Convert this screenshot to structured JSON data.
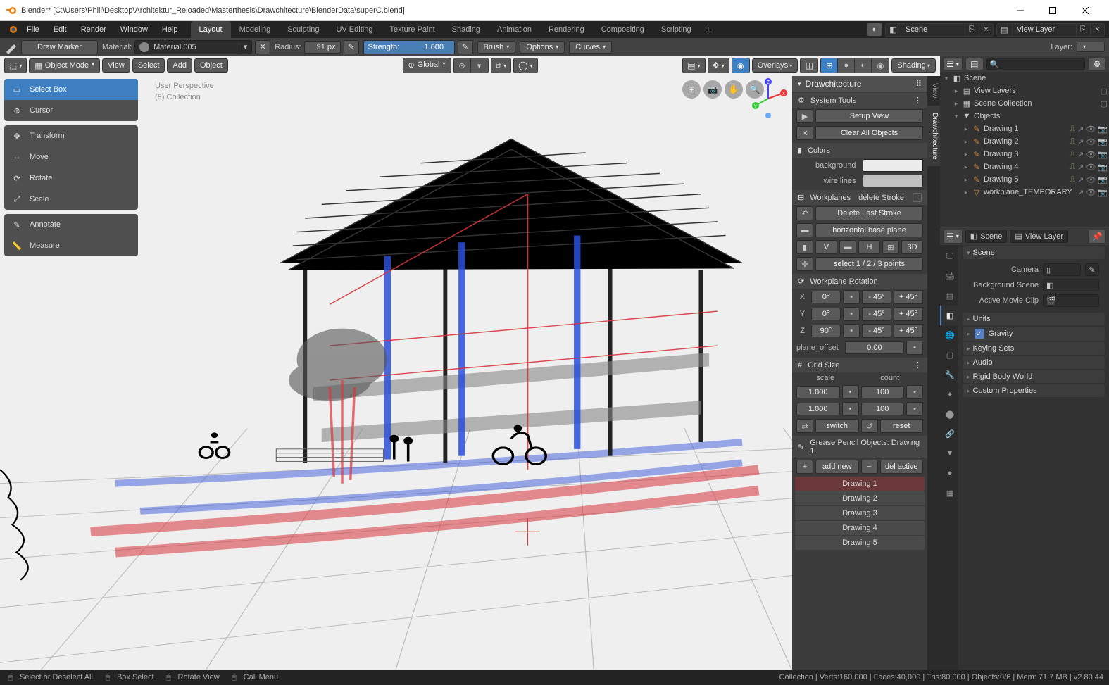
{
  "titlebar": {
    "title": "Blender* [C:\\Users\\Phili\\Desktop\\Architektur_Reloaded\\Masterthesis\\Drawchitecture\\BlenderData\\superC.blend]"
  },
  "menubar": {
    "items": [
      "File",
      "Edit",
      "Render",
      "Window",
      "Help"
    ],
    "tabs": [
      "Layout",
      "Modeling",
      "Sculpting",
      "UV Editing",
      "Texture Paint",
      "Shading",
      "Animation",
      "Rendering",
      "Compositing",
      "Scripting"
    ],
    "active_tab": 0,
    "scene_label": "Scene",
    "viewlayer_label": "View Layer"
  },
  "toolbar2": {
    "draw_label": "Draw Marker",
    "material_label": "Material:",
    "material_value": "Material.005",
    "radius_label": "Radius:",
    "radius_value": "91 px",
    "strength_label": "Strength:",
    "strength_value": "1.000",
    "brush_label": "Brush",
    "options_label": "Options",
    "curves_label": "Curves",
    "layer_label": "Layer:"
  },
  "vp_header": {
    "mode": "Object Mode",
    "view": "View",
    "select": "Select",
    "add": "Add",
    "object": "Object",
    "orientation": "Global",
    "overlays": "Overlays",
    "shading": "Shading"
  },
  "tools": {
    "groups": [
      [
        "Select Box",
        "Cursor"
      ],
      [
        "Transform",
        "Move",
        "Rotate",
        "Scale"
      ],
      [
        "Annotate",
        "Measure"
      ]
    ],
    "active": "Select Box"
  },
  "vp_overlay": {
    "line1": "User Perspective",
    "line2": "(9) Collection"
  },
  "npanel": {
    "title": "Drawchitecture",
    "tabs": [
      "View",
      "Drawchitecture"
    ],
    "active_tab": 1,
    "system_tools": {
      "title": "System Tools",
      "setup": "Setup View",
      "clear": "Clear All Objects"
    },
    "colors": {
      "title": "Colors",
      "background": "background",
      "wire": "wire lines",
      "bg_hex": "#ececec",
      "wire_hex": "#c0c0c0"
    },
    "workplanes": {
      "title": "Workplanes",
      "delete_stroke": "delete Stroke",
      "delete_last": "Delete Last Stroke",
      "horizontal": "horizontal base plane",
      "modes": [
        "V",
        "H",
        "3D"
      ],
      "select_pts": "select 1 / 2 / 3 points"
    },
    "rotation": {
      "title": "Workplane Rotation",
      "axes": [
        "X",
        "Y",
        "Z"
      ],
      "vals": [
        "0°",
        "0°",
        "90°"
      ],
      "minus": "- 45°",
      "plus": "+ 45°",
      "offset_label": "plane_offset",
      "offset_value": "0.00"
    },
    "grid": {
      "title": "Grid Size",
      "scale_label": "scale",
      "count_label": "count",
      "scale1": "1.000",
      "scale2": "1.000",
      "count1": "100",
      "count2": "100",
      "switch": "switch",
      "reset": "reset"
    },
    "gp": {
      "title": "Grease Pencil Objects: Drawing 1",
      "add": "add new",
      "del": "del active",
      "items": [
        "Drawing 1",
        "Drawing 2",
        "Drawing 3",
        "Drawing 4",
        "Drawing 5"
      ],
      "active": 0
    }
  },
  "outliner": {
    "scene": "Scene",
    "view_layers": "View Layers",
    "scene_collection": "Scene Collection",
    "objects": "Objects",
    "items": [
      "Drawing 1",
      "Drawing 2",
      "Drawing 3",
      "Drawing 4",
      "Drawing 5",
      "workplane_TEMPORARY"
    ]
  },
  "props": {
    "scene_tab": "Scene",
    "viewlayer_tab": "View Layer",
    "panels": {
      "scene": "Scene",
      "camera": "Camera",
      "bg_scene": "Background Scene",
      "movie_clip": "Active Movie Clip",
      "units": "Units",
      "gravity": "Gravity",
      "keying": "Keying Sets",
      "audio": "Audio",
      "rigid": "Rigid Body World",
      "custom": "Custom Properties"
    }
  },
  "statusbar": {
    "items": [
      "Select or Deselect All",
      "Box Select",
      "Rotate View",
      "Call Menu"
    ],
    "stats": "Collection | Verts:160,000 | Faces:40,000 | Tris:80,000 | Objects:0/6 | Mem: 71.7 MB | v2.80.44"
  }
}
